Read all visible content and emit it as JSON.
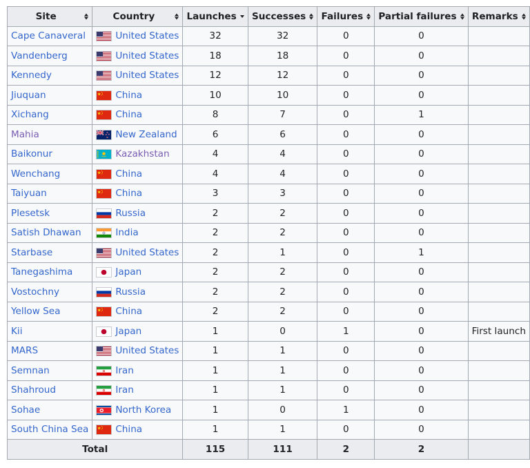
{
  "headers": {
    "site": "Site",
    "country": "Country",
    "launches": "Launches",
    "successes": "Successes",
    "failures": "Failures",
    "partial": "Partial failures",
    "remarks": "Remarks"
  },
  "rows": [
    {
      "site": "Cape Canaveral",
      "country": "United States",
      "flag": "us-flag-icon",
      "launches": "32",
      "successes": "32",
      "failures": "0",
      "partial": "0",
      "remarks": ""
    },
    {
      "site": "Vandenberg",
      "country": "United States",
      "flag": "us-flag-icon",
      "launches": "18",
      "successes": "18",
      "failures": "0",
      "partial": "0",
      "remarks": ""
    },
    {
      "site": "Kennedy",
      "country": "United States",
      "flag": "us-flag-icon",
      "launches": "12",
      "successes": "12",
      "failures": "0",
      "partial": "0",
      "remarks": ""
    },
    {
      "site": "Jiuquan",
      "country": "China",
      "flag": "china-flag-icon",
      "launches": "10",
      "successes": "10",
      "failures": "0",
      "partial": "0",
      "remarks": ""
    },
    {
      "site": "Xichang",
      "country": "China",
      "flag": "china-flag-icon",
      "launches": "8",
      "successes": "7",
      "failures": "0",
      "partial": "1",
      "remarks": ""
    },
    {
      "site": "Mahia",
      "country": "New Zealand",
      "flag": "new-zealand-flag-icon",
      "launches": "6",
      "successes": "6",
      "failures": "0",
      "partial": "0",
      "remarks": ""
    },
    {
      "site": "Baikonur",
      "country": "Kazakhstan",
      "flag": "kazakhstan-flag-icon",
      "launches": "4",
      "successes": "4",
      "failures": "0",
      "partial": "0",
      "remarks": ""
    },
    {
      "site": "Wenchang",
      "country": "China",
      "flag": "china-flag-icon",
      "launches": "4",
      "successes": "4",
      "failures": "0",
      "partial": "0",
      "remarks": ""
    },
    {
      "site": "Taiyuan",
      "country": "China",
      "flag": "china-flag-icon",
      "launches": "3",
      "successes": "3",
      "failures": "0",
      "partial": "0",
      "remarks": ""
    },
    {
      "site": "Plesetsk",
      "country": "Russia",
      "flag": "russia-flag-icon",
      "launches": "2",
      "successes": "2",
      "failures": "0",
      "partial": "0",
      "remarks": ""
    },
    {
      "site": "Satish Dhawan",
      "country": "India",
      "flag": "india-flag-icon",
      "launches": "2",
      "successes": "2",
      "failures": "0",
      "partial": "0",
      "remarks": ""
    },
    {
      "site": "Starbase",
      "country": "United States",
      "flag": "us-flag-icon",
      "launches": "2",
      "successes": "1",
      "failures": "0",
      "partial": "1",
      "remarks": ""
    },
    {
      "site": "Tanegashima",
      "country": "Japan",
      "flag": "japan-flag-icon",
      "launches": "2",
      "successes": "2",
      "failures": "0",
      "partial": "0",
      "remarks": ""
    },
    {
      "site": "Vostochny",
      "country": "Russia",
      "flag": "russia-flag-icon",
      "launches": "2",
      "successes": "2",
      "failures": "0",
      "partial": "0",
      "remarks": ""
    },
    {
      "site": "Yellow Sea",
      "country": "China",
      "flag": "china-flag-icon",
      "launches": "2",
      "successes": "2",
      "failures": "0",
      "partial": "0",
      "remarks": ""
    },
    {
      "site": "Kii",
      "country": "Japan",
      "flag": "japan-flag-icon",
      "launches": "1",
      "successes": "0",
      "failures": "1",
      "partial": "0",
      "remarks": "First launch"
    },
    {
      "site": "MARS",
      "country": "United States",
      "flag": "us-flag-icon",
      "launches": "1",
      "successes": "1",
      "failures": "0",
      "partial": "0",
      "remarks": ""
    },
    {
      "site": "Semnan",
      "country": "Iran",
      "flag": "iran-flag-icon",
      "launches": "1",
      "successes": "1",
      "failures": "0",
      "partial": "0",
      "remarks": ""
    },
    {
      "site": "Shahroud",
      "country": "Iran",
      "flag": "iran-flag-icon",
      "launches": "1",
      "successes": "1",
      "failures": "0",
      "partial": "0",
      "remarks": ""
    },
    {
      "site": "Sohae",
      "country": "North Korea",
      "flag": "north-korea-flag-icon",
      "launches": "1",
      "successes": "0",
      "failures": "1",
      "partial": "0",
      "remarks": ""
    },
    {
      "site": "South China Sea",
      "country": "China",
      "flag": "china-flag-icon",
      "launches": "1",
      "successes": "1",
      "failures": "0",
      "partial": "0",
      "remarks": ""
    }
  ],
  "visited_links": [
    "Mahia",
    "Kazakhstan"
  ],
  "total": {
    "label": "Total",
    "launches": "115",
    "successes": "111",
    "failures": "2",
    "partial": "2"
  },
  "sort": {
    "column": "launches",
    "direction": "descending"
  },
  "colors": {
    "link": "#3366cc",
    "visited_link": "#795cb2",
    "header_bg": "#eaecf0",
    "cell_bg": "#f8f9fa",
    "border": "#a2a9b1"
  }
}
